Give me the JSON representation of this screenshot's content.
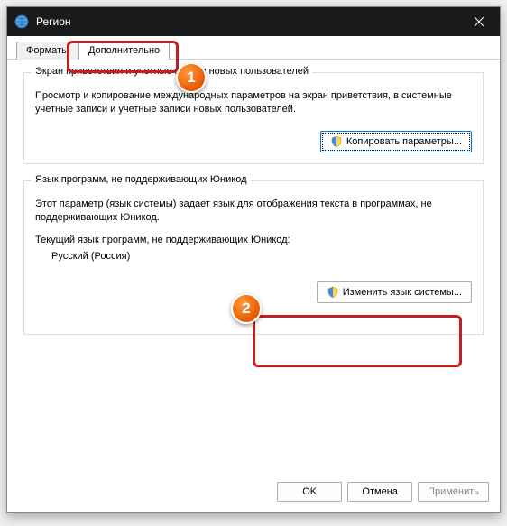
{
  "titlebar": {
    "title": "Регион"
  },
  "tabs": {
    "formats": "Форматы",
    "advanced": "Дополнительно"
  },
  "group1": {
    "title": "Экран приветствия и учетные записи новых пользователей",
    "text": "Просмотр и копирование международных параметров на экран приветствия, в системные учетные записи и учетные записи новых пользователей.",
    "button": "Копировать параметры..."
  },
  "group2": {
    "title": "Язык программ, не поддерживающих Юникод",
    "text": "Этот параметр (язык системы) задает язык для отображения текста в программах, не поддерживающих Юникод.",
    "currentLabel": "Текущий язык программ, не поддерживающих Юникод:",
    "currentValue": "Русский (Россия)",
    "button": "Изменить язык системы..."
  },
  "footer": {
    "ok": "OK",
    "cancel": "Отмена",
    "apply": "Применить"
  },
  "markers": {
    "one": "1",
    "two": "2"
  }
}
